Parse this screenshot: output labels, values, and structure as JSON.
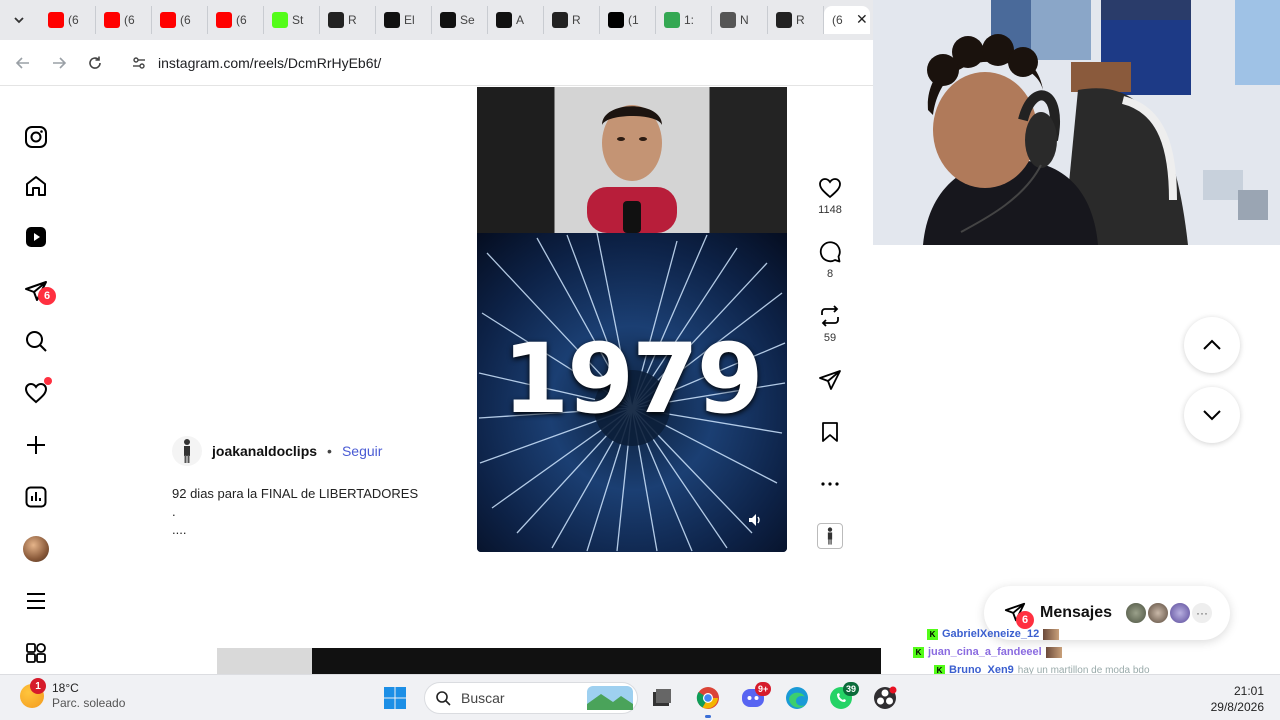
{
  "browser": {
    "tabs": [
      {
        "label": "(6",
        "icon": "youtube-icon",
        "color": "#ff0000"
      },
      {
        "label": "(6",
        "icon": "youtube-icon",
        "color": "#ff0000"
      },
      {
        "label": "(6",
        "icon": "youtube-icon",
        "color": "#ff0000"
      },
      {
        "label": "(6",
        "icon": "youtube-icon",
        "color": "#ff0000"
      },
      {
        "label": "St",
        "icon": "kick-icon",
        "color": "#53fc18"
      },
      {
        "label": "R",
        "icon": "shield-icon",
        "color": "#222222"
      },
      {
        "label": "El",
        "icon": "news-icon",
        "color": "#111111"
      },
      {
        "label": "Se",
        "icon": "grid-icon",
        "color": "#111111"
      },
      {
        "label": "A",
        "icon": "soccer-ball-icon",
        "color": "#111111"
      },
      {
        "label": "R",
        "icon": "shield-icon",
        "color": "#222222"
      },
      {
        "label": "(1",
        "icon": "x-icon",
        "color": "#000000"
      },
      {
        "label": "1:",
        "icon": "maps-pin-icon",
        "color": "#34a853"
      },
      {
        "label": "N",
        "icon": "shield-icon",
        "color": "#555555"
      },
      {
        "label": "R",
        "icon": "shield-icon",
        "color": "#222222"
      }
    ],
    "active_tab_label": "(6",
    "url": "instagram.com/reels/DcmRrHyEb6t/"
  },
  "sidebar": {
    "items": [
      {
        "name": "instagram-logo-icon"
      },
      {
        "name": "home-icon"
      },
      {
        "name": "reels-icon"
      },
      {
        "name": "messages-icon",
        "badge": "6"
      },
      {
        "name": "search-icon"
      },
      {
        "name": "notifications-heart-icon",
        "dot": true
      },
      {
        "name": "create-plus-icon"
      },
      {
        "name": "dashboard-icon"
      },
      {
        "name": "profile-avatar"
      },
      {
        "name": "menu-icon"
      },
      {
        "name": "also-from-meta-icon"
      }
    ]
  },
  "post": {
    "author": "joakanaldoclips",
    "separator": "•",
    "follow_label": "Seguir",
    "caption_lines": [
      "92 dias para la FINAL de LIBERTADORES",
      ".",
      "...."
    ],
    "video_text": "1979"
  },
  "actions": {
    "likes": "1148",
    "comments": "8",
    "reposts": "59"
  },
  "messages": {
    "label": "Mensajes",
    "badge": "6"
  },
  "chat": [
    {
      "user": "GabrielXeneize_12",
      "color": "#3b5fcf",
      "message": ""
    },
    {
      "user": "juan_cina_a_fandeeel",
      "color": "#8a6be0",
      "message": ""
    },
    {
      "user": "Bruno_Xen9",
      "color": "#3b5fcf",
      "message": "hay un martillon de moda bdo"
    }
  ],
  "taskbar": {
    "weather_badge": "1",
    "temperature": "18°C",
    "condition": "Parc. soleado",
    "search_placeholder": "Buscar",
    "discord_badge": "9+",
    "whatsapp_badge": "39",
    "time": "21:01",
    "date": "29/8/2026"
  },
  "colors": {
    "accent_link": "#4a5bd4",
    "badge_red": "#ff3040",
    "kick_green": "#53fc18"
  }
}
